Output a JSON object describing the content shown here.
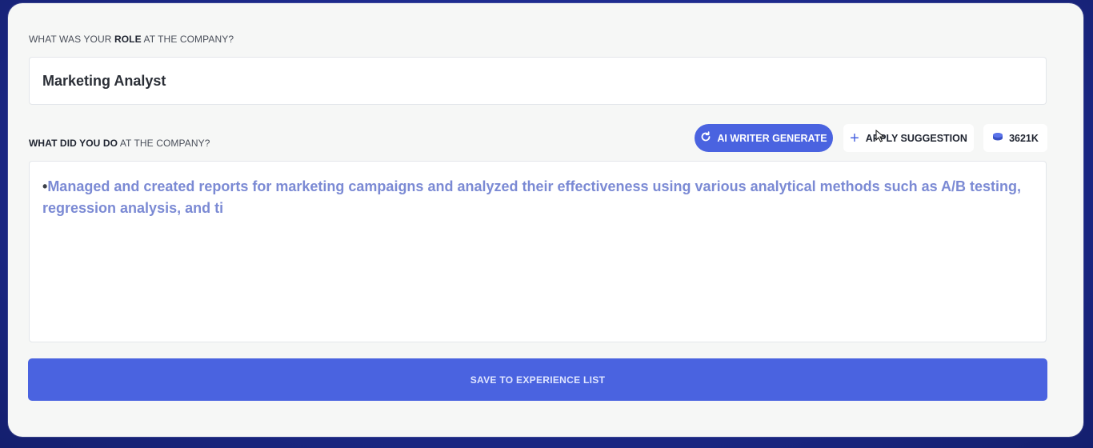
{
  "form": {
    "role_label_prefix": "WHAT WAS YOUR ",
    "role_label_bold": "ROLE",
    "role_label_suffix": " AT THE COMPANY?",
    "role_value": "Marketing Analyst",
    "did_label_bold": "WHAT DID YOU DO",
    "did_label_suffix": " AT THE COMPANY?",
    "description_bullet": "•",
    "description_value": "Managed and created reports for marketing campaigns and analyzed their effectiveness using various analytical methods such as A/B testing, regression analysis, and ti"
  },
  "toolbar": {
    "ai_writer_label": "AI WRITER GENERATE",
    "ai_writer_icon": "refresh-icon",
    "apply_label": "APPLY SUGGESTION",
    "apply_icon": "plus-icon",
    "credits_value": "3621K",
    "credits_icon": "coin-stack-icon"
  },
  "actions": {
    "save_label": "SAVE TO EXPERIENCE LIST"
  },
  "colors": {
    "accent": "#4a63e0",
    "suggestion_text": "#7b8ad4",
    "card_bg": "#f6f7f6",
    "page_bg": "#1d2a8c"
  }
}
